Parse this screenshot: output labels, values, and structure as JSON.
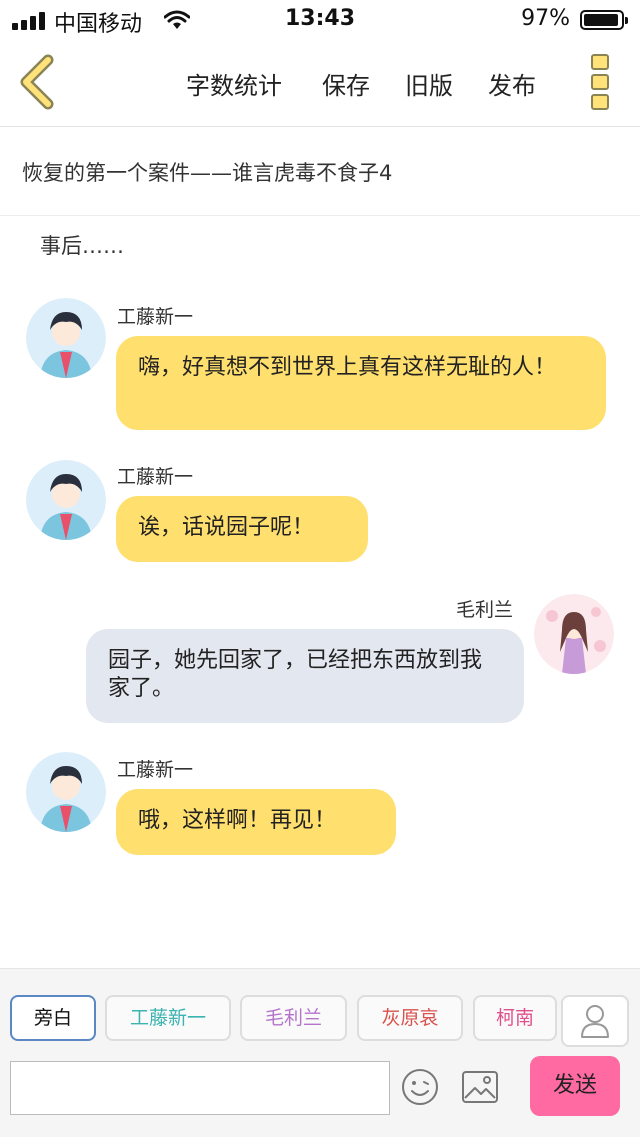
{
  "status_bar": {
    "carrier": "中国移动",
    "time": "13:43",
    "battery_percent": "97%",
    "battery_level": 0.97,
    "signal_bars": 4
  },
  "nav": {
    "back_icon": "chevron-left-icon",
    "items": [
      "字数统计",
      "保存",
      "旧版",
      "发布"
    ],
    "more_icon": "more-vertical-icon"
  },
  "story_title": "恢复的第一个案件——谁言虎毒不食子4",
  "chat": {
    "narration": "事后……",
    "messages": [
      {
        "speaker": "工藤新一",
        "side": "left",
        "text": "嗨，好真想不到世界上真有这样无耻的人！"
      },
      {
        "speaker": "工藤新一",
        "side": "left",
        "text": "诶，话说园子呢！"
      },
      {
        "speaker": "毛利兰",
        "side": "right",
        "text": "园子，她先回家了，已经把东西放到我家了。"
      },
      {
        "speaker": "工藤新一",
        "side": "left",
        "text": "哦，这样啊！再见！"
      }
    ]
  },
  "toolbar": {
    "characters": [
      {
        "label": "旁白",
        "color": "#111111"
      },
      {
        "label": "工藤新一",
        "color": "#3bb3b0"
      },
      {
        "label": "毛利兰",
        "color": "#b574cc"
      },
      {
        "label": "灰原哀",
        "color": "#d9534f"
      },
      {
        "label": "柯南",
        "color": "#e0508c"
      }
    ],
    "person_icon": "person-icon",
    "input": {
      "value": "",
      "placeholder": ""
    },
    "emoji_icon": "emoji-icon",
    "image_icon": "image-icon",
    "send_label": "发送"
  },
  "colors": {
    "accent_yellow": "#ffdf6e",
    "bubble_gray": "#e3e7ef",
    "send_pink": "#ff6aa2"
  }
}
